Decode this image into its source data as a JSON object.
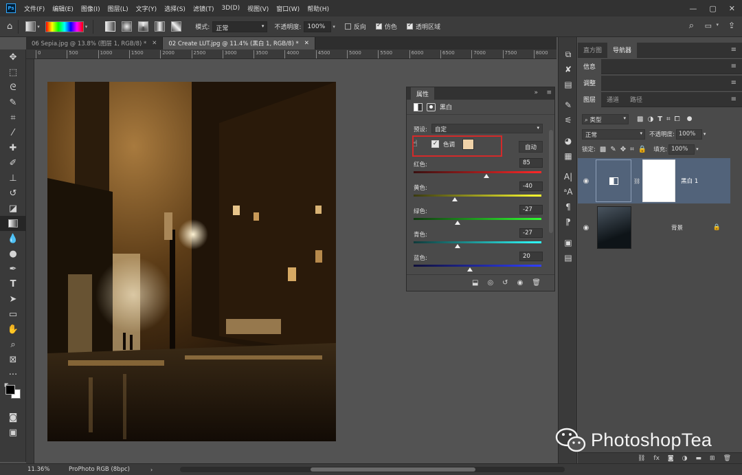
{
  "menubar": {
    "logo": "Ps",
    "items": [
      "文件(F)",
      "编辑(E)",
      "图像(I)",
      "图层(L)",
      "文字(Y)",
      "选择(S)",
      "滤镜(T)",
      "3D(D)",
      "视图(V)",
      "窗口(W)",
      "帮助(H)"
    ]
  },
  "optbar": {
    "mode_label": "模式:",
    "mode_value": "正常",
    "opacity_label": "不透明度:",
    "opacity_value": "100%",
    "reverse_label": "反向",
    "dither_label": "仿色",
    "transparency_label": "透明区域"
  },
  "tabs": [
    {
      "label": "06 Sepia.jpg @ 13.8% (图层 1, RGB/8) *"
    },
    {
      "label": "02 Create LUT.jpg @ 11.4% (黑白 1, RGB/8) *"
    }
  ],
  "ruler": [
    "0",
    "500",
    "1000",
    "1500",
    "2000",
    "2500",
    "3000",
    "3500",
    "4000",
    "4500",
    "5000",
    "5500",
    "6000",
    "6500",
    "7000",
    "7500",
    "8000"
  ],
  "properties": {
    "tab": "属性",
    "title": "黑白",
    "preset_label": "预设:",
    "preset_value": "自定",
    "tint_label": "色调",
    "tint_color": "#f0d2a8",
    "auto_label": "自动",
    "sliders": [
      {
        "label": "红色:",
        "value": 85
      },
      {
        "label": "黄色:",
        "value": -40
      },
      {
        "label": "绿色:",
        "value": -27
      },
      {
        "label": "青色:",
        "value": -27
      },
      {
        "label": "蓝色:",
        "value": 20
      }
    ]
  },
  "right": {
    "tabs1": [
      "直方图",
      "导航器"
    ],
    "info": "信息",
    "adjust": "调整",
    "tabs2": [
      "图层",
      "通道",
      "路径"
    ],
    "filter_value": "类型",
    "blend_value": "正常",
    "opacity_label": "不透明度:",
    "opacity_value": "100%",
    "lock_label": "锁定:",
    "fill_label": "填充:",
    "fill_value": "100%",
    "layers": [
      {
        "name": "黑白 1"
      },
      {
        "name": "背景"
      }
    ]
  },
  "status": {
    "zoom": "11.36%",
    "profile": "ProPhoto RGB (8bpc)"
  },
  "watermark": "PhotoshopTea",
  "colors": {
    "highlight_box": "#d42a2a",
    "selected_layer": "#52637a"
  }
}
